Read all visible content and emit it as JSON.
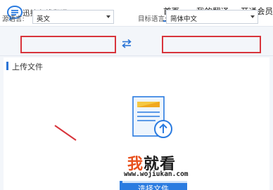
{
  "app": {
    "title": "迅捷在线翻译",
    "logo_icon": "chat-bubble-lines-icon"
  },
  "nav": {
    "items": [
      {
        "label": "首页",
        "active": true
      },
      {
        "label": "我的翻译",
        "active": false
      },
      {
        "label": "开通会员",
        "active": false
      }
    ]
  },
  "language": {
    "source_label": "源语言:",
    "source_value": "英文",
    "target_label": "目标语言:",
    "target_value": "简体中文",
    "swap_icon": "swap-arrows-icon"
  },
  "upload": {
    "section_title": "上传文件",
    "document_icon": "document-upload-icon",
    "select_button_label": "选择文件"
  },
  "watermark": {
    "brand_first": "我",
    "brand_rest": "就看",
    "url": "www.wojiukan.com"
  },
  "colors": {
    "accent": "#2a74d6",
    "highlight_box": "#d8343b",
    "watermark_orange": "#e8501c"
  }
}
